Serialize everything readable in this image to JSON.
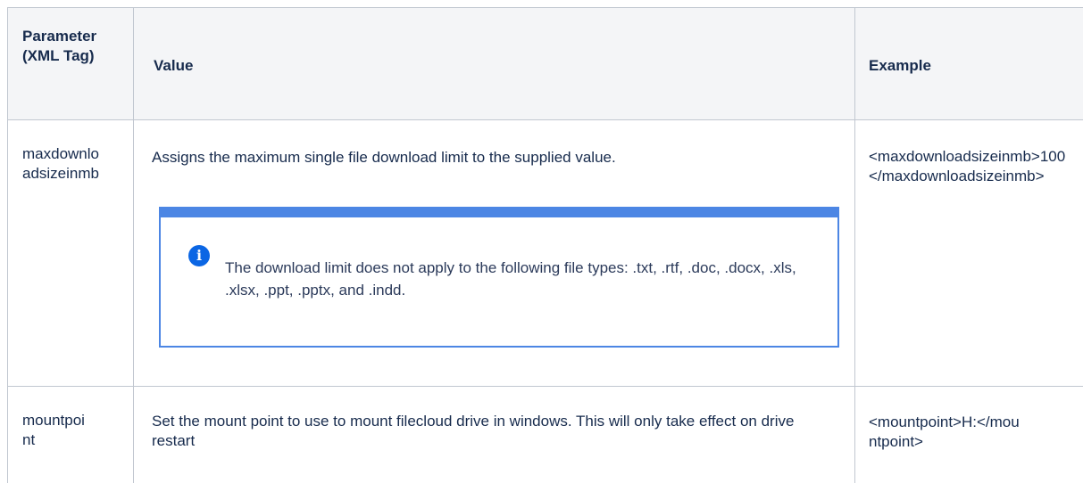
{
  "table": {
    "headers": {
      "parameter": "Parameter (XML Tag)",
      "value": "Value",
      "example": "Example"
    },
    "rows": [
      {
        "parameter": "maxdownloadsizeinmb",
        "value": "Assigns the maximum single file download limit to the supplied value.",
        "note": {
          "icon": "info-icon",
          "text": "The download limit does not apply to the following file types: .txt, .rtf, .doc, .docx, .xls, .xlsx, .ppt, .pptx, and .indd."
        },
        "example": "<maxdownloadsizeinmb>100</maxdownloadsizeinmb>"
      },
      {
        "parameter": "mountpoint",
        "value": "Set the mount point to use to mount filecloud drive in windows. This will only take effect on drive restart",
        "example": "<mountpoint>H:</mountpoint>"
      }
    ]
  },
  "colors": {
    "header_bg": "#f4f5f7",
    "grid_line": "#c1c7d0",
    "note_border": "#4c86e4",
    "info_icon": "#0b66e4"
  }
}
